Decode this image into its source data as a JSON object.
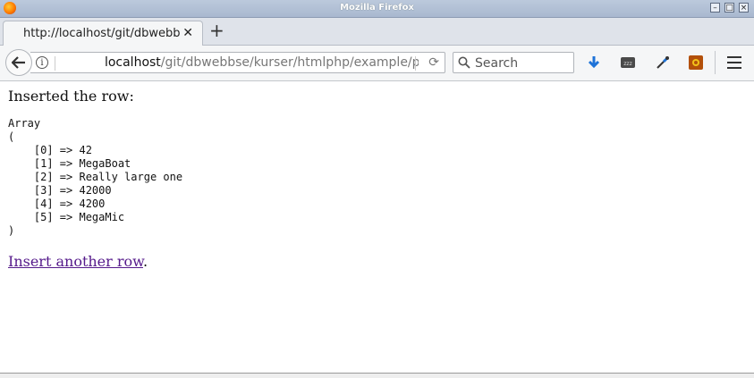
{
  "window": {
    "title": "Mozilla Firefox"
  },
  "tab": {
    "title": "http://localhost/git/dbwebbse/kurser/htmlphp/example/pdo-sqlite"
  },
  "urlbar": {
    "host": "localhost",
    "path": "/git/dbwebbse/kurser/htmlphp/example/pdo-sqlit"
  },
  "search": {
    "placeholder": "Search"
  },
  "page": {
    "heading": "Inserted the row:",
    "array_open": "Array\n(",
    "rows": [
      "    [0] => 42",
      "    [1] => MegaBoat",
      "    [2] => Really large one",
      "    [3] => 42000",
      "    [4] => 4200",
      "    [5] => MegaMic"
    ],
    "array_close": ")",
    "link_text": "Insert another row",
    "link_suffix": "."
  },
  "icons": [
    "firefox-logo-icon",
    "minimize-icon",
    "maximize-icon",
    "close-window-icon",
    "tab-close-icon",
    "new-tab-icon",
    "back-arrow-icon",
    "site-info-icon",
    "reload-icon",
    "search-icon",
    "download-icon",
    "sleep-icon",
    "eyedropper-icon",
    "extension-icon",
    "menu-icon"
  ]
}
